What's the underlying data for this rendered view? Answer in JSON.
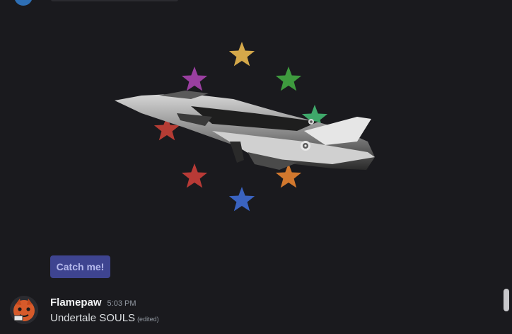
{
  "embed": {
    "button_label": "Catch me!",
    "star_colors": [
      "#d4a84a",
      "#9a3fa0",
      "#3e9a3e",
      "#3fa86a",
      "#b53c34",
      "#b83a36",
      "#d2782e",
      "#3a63c0"
    ]
  },
  "message": {
    "username": "Flamepaw",
    "timestamp": "5:03 PM",
    "content": "Undertale SOULS",
    "edited_label": "(edited)"
  },
  "colors": {
    "background": "#1a1a1e",
    "button": "#3e4490",
    "button_text": "#b5b9ec"
  }
}
